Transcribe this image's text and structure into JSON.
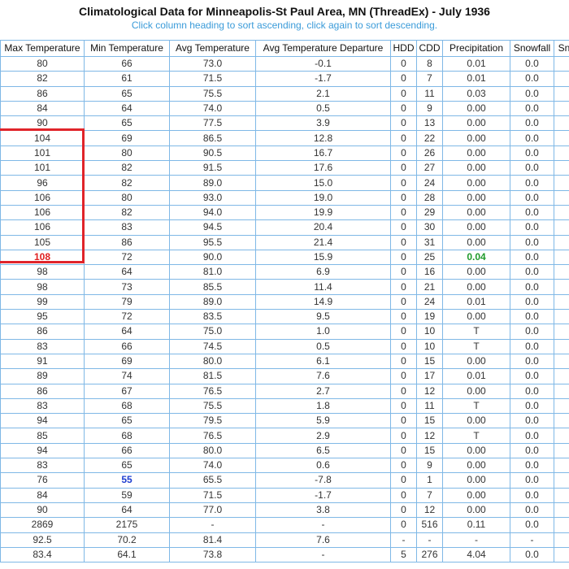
{
  "page": {
    "title": "Climatological Data for Minneapolis-St Paul Area, MN (ThreadEx) - July 1936",
    "subtitle": "Click column heading to sort ascending, click again to sort descending."
  },
  "colors": {
    "header_border": "#7fb8e6",
    "subtitle": "#3a9bd9",
    "highlight_box": "#e0242a",
    "record_high": "#e02020",
    "record_low": "#1f3fd0",
    "max_precip": "#1e9a2a"
  },
  "table": {
    "columns": [
      "Max Temperature",
      "Min Temperature",
      "Avg Temperature",
      "Avg Temperature Departure",
      "HDD",
      "CDD",
      "Precipitation",
      "Snowfall",
      "Sn"
    ],
    "rows": [
      [
        "80",
        "66",
        "73.0",
        "-0.1",
        "0",
        "8",
        "0.01",
        "0.0"
      ],
      [
        "82",
        "61",
        "71.5",
        "-1.7",
        "0",
        "7",
        "0.01",
        "0.0"
      ],
      [
        "86",
        "65",
        "75.5",
        "2.1",
        "0",
        "11",
        "0.03",
        "0.0"
      ],
      [
        "84",
        "64",
        "74.0",
        "0.5",
        "0",
        "9",
        "0.00",
        "0.0"
      ],
      [
        "90",
        "65",
        "77.5",
        "3.9",
        "0",
        "13",
        "0.00",
        "0.0"
      ],
      [
        "104",
        "69",
        "86.5",
        "12.8",
        "0",
        "22",
        "0.00",
        "0.0"
      ],
      [
        "101",
        "80",
        "90.5",
        "16.7",
        "0",
        "26",
        "0.00",
        "0.0"
      ],
      [
        "101",
        "82",
        "91.5",
        "17.6",
        "0",
        "27",
        "0.00",
        "0.0"
      ],
      [
        "96",
        "82",
        "89.0",
        "15.0",
        "0",
        "24",
        "0.00",
        "0.0"
      ],
      [
        "106",
        "80",
        "93.0",
        "19.0",
        "0",
        "28",
        "0.00",
        "0.0"
      ],
      [
        "106",
        "82",
        "94.0",
        "19.9",
        "0",
        "29",
        "0.00",
        "0.0"
      ],
      [
        "106",
        "83",
        "94.5",
        "20.4",
        "0",
        "30",
        "0.00",
        "0.0"
      ],
      [
        "105",
        "86",
        "95.5",
        "21.4",
        "0",
        "31",
        "0.00",
        "0.0"
      ],
      [
        "108",
        "72",
        "90.0",
        "15.9",
        "0",
        "25",
        "0.04",
        "0.0"
      ],
      [
        "98",
        "64",
        "81.0",
        "6.9",
        "0",
        "16",
        "0.00",
        "0.0"
      ],
      [
        "98",
        "73",
        "85.5",
        "11.4",
        "0",
        "21",
        "0.00",
        "0.0"
      ],
      [
        "99",
        "79",
        "89.0",
        "14.9",
        "0",
        "24",
        "0.01",
        "0.0"
      ],
      [
        "95",
        "72",
        "83.5",
        "9.5",
        "0",
        "19",
        "0.00",
        "0.0"
      ],
      [
        "86",
        "64",
        "75.0",
        "1.0",
        "0",
        "10",
        "T",
        "0.0"
      ],
      [
        "83",
        "66",
        "74.5",
        "0.5",
        "0",
        "10",
        "T",
        "0.0"
      ],
      [
        "91",
        "69",
        "80.0",
        "6.1",
        "0",
        "15",
        "0.00",
        "0.0"
      ],
      [
        "89",
        "74",
        "81.5",
        "7.6",
        "0",
        "17",
        "0.01",
        "0.0"
      ],
      [
        "86",
        "67",
        "76.5",
        "2.7",
        "0",
        "12",
        "0.00",
        "0.0"
      ],
      [
        "83",
        "68",
        "75.5",
        "1.8",
        "0",
        "11",
        "T",
        "0.0"
      ],
      [
        "94",
        "65",
        "79.5",
        "5.9",
        "0",
        "15",
        "0.00",
        "0.0"
      ],
      [
        "85",
        "68",
        "76.5",
        "2.9",
        "0",
        "12",
        "T",
        "0.0"
      ],
      [
        "94",
        "66",
        "80.0",
        "6.5",
        "0",
        "15",
        "0.00",
        "0.0"
      ],
      [
        "83",
        "65",
        "74.0",
        "0.6",
        "0",
        "9",
        "0.00",
        "0.0"
      ],
      [
        "76",
        "55",
        "65.5",
        "-7.8",
        "0",
        "1",
        "0.00",
        "0.0"
      ],
      [
        "84",
        "59",
        "71.5",
        "-1.7",
        "0",
        "7",
        "0.00",
        "0.0"
      ],
      [
        "90",
        "64",
        "77.0",
        "3.8",
        "0",
        "12",
        "0.00",
        "0.0"
      ]
    ],
    "summary_rows": [
      [
        "2869",
        "2175",
        "-",
        "-",
        "0",
        "516",
        "0.11",
        "0.0"
      ],
      [
        "92.5",
        "70.2",
        "81.4",
        "7.6",
        "-",
        "-",
        "-",
        "-"
      ],
      [
        "83.4",
        "64.1",
        "73.8",
        "-",
        "5",
        "276",
        "4.04",
        "0.0"
      ]
    ],
    "record_high_cell": [
      13,
      0
    ],
    "record_low_cell": [
      28,
      1
    ],
    "max_precip_cell": [
      13,
      6
    ]
  }
}
